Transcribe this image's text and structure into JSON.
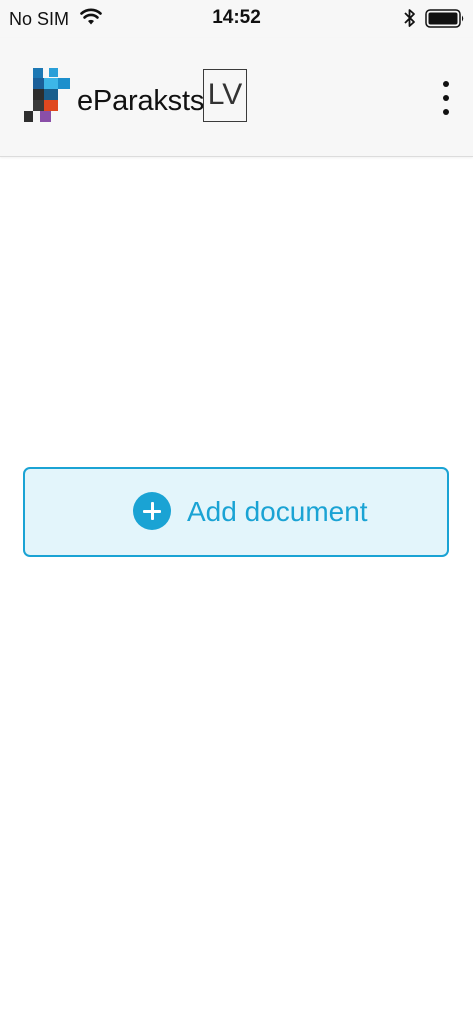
{
  "status_bar": {
    "carrier": "No SIM",
    "time": "14:52",
    "icons": [
      "wifi-icon",
      "bluetooth-icon",
      "battery-icon"
    ]
  },
  "app_bar": {
    "brand": "eParaksts",
    "language": "LV",
    "logo": "eparaksts-logo",
    "menu_icon": "more-vertical-icon"
  },
  "main": {
    "add_document_label": "Add document",
    "add_icon": "plus-circle-icon"
  },
  "colors": {
    "accent": "#1aa3d4",
    "button_background": "#e3f5fb",
    "bar_background": "#f7f7f7"
  }
}
